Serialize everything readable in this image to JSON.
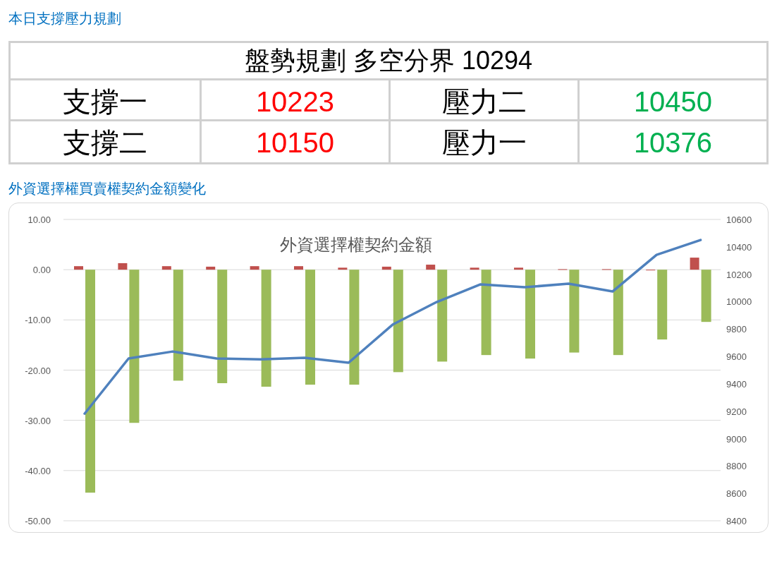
{
  "plan_heading": "本日支撐壓力規劃",
  "plan_table": {
    "title": "盤勢規劃 多空分界 10294",
    "rows": [
      {
        "cells": [
          {
            "label": "支撐一",
            "value": "10223",
            "kind": "support"
          },
          {
            "label": "壓力二",
            "value": "10450",
            "kind": "resistance"
          }
        ]
      },
      {
        "cells": [
          {
            "label": "支撐二",
            "value": "10150",
            "kind": "support"
          },
          {
            "label": "壓力一",
            "value": "10376",
            "kind": "resistance"
          }
        ]
      }
    ]
  },
  "chart_heading": "外資選擇權買賣權契約金額變化",
  "chart": {
    "chart_data": {
      "type": "bar",
      "title": "外資選擇權契約金額",
      "grid": true,
      "ylim": [
        -50,
        10
      ],
      "yticks": [
        {
          "value": 10,
          "label": "10.00"
        },
        {
          "value": 0,
          "label": "0.00"
        },
        {
          "value": -10,
          "label": "-10.00"
        },
        {
          "value": -20,
          "label": "-20.00"
        },
        {
          "value": -30,
          "label": "-30.00"
        },
        {
          "value": -40,
          "label": "-40.00"
        },
        {
          "value": -50,
          "label": "-50.00"
        }
      ],
      "y2lim": [
        8400,
        10600
      ],
      "y2ticks": [
        8400,
        8600,
        8800,
        9000,
        9200,
        9400,
        9600,
        9800,
        10000,
        10200,
        10400,
        10600
      ],
      "series": [
        {
          "color": "#c0504d",
          "values": [
            0.7,
            1.3,
            0.7,
            0.6,
            0.7,
            0.7,
            0.4,
            0.6,
            1.0,
            0.4,
            0.4,
            0.1,
            0.1,
            -0.1,
            2.4
          ]
        },
        {
          "color": "#9bbb59",
          "values": [
            -44.4,
            -30.5,
            -22.1,
            -22.6,
            -23.3,
            -22.9,
            -22.9,
            -20.4,
            -18.3,
            -17.0,
            -17.7,
            -16.5,
            -17.0,
            -13.9,
            -10.4
          ]
        },
        {
          "color": "#4f81bd",
          "type": "line",
          "axis": "y2",
          "values": [
            9182,
            9585,
            9636,
            9585,
            9579,
            9590,
            9554,
            9832,
            9997,
            10126,
            10105,
            10131,
            10074,
            10342,
            10450
          ]
        }
      ]
    }
  }
}
